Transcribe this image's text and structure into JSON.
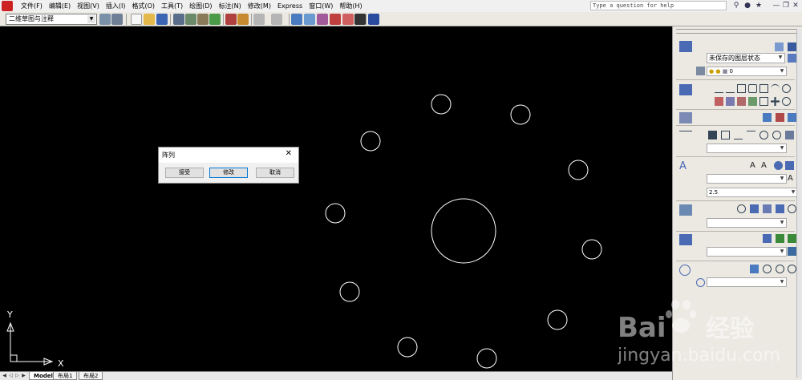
{
  "menubar": {
    "items": [
      "文件(F)",
      "编辑(E)",
      "视图(V)",
      "插入(I)",
      "格式(O)",
      "工具(T)",
      "绘图(D)",
      "标注(N)",
      "修改(M)",
      "Express",
      "窗口(W)",
      "帮助(H)"
    ],
    "help_placeholder": "Type a question for help"
  },
  "toolbar": {
    "workspace": "二维草图与注释"
  },
  "canvas": {
    "background": "#000000",
    "ucs_x_label": "X",
    "ucs_y_label": "Y"
  },
  "layout_tabs": [
    "Model",
    "布局1",
    "布局2"
  ],
  "dashboard": {
    "layer_state": "未保存的图层状态",
    "layer_current": "0",
    "text_height": "2.5"
  },
  "array_dialog": {
    "title": "阵列",
    "close_symbol": "✕",
    "buttons": {
      "accept": "接受",
      "modify": "修改",
      "cancel": "取消"
    }
  },
  "watermark": {
    "brand": "Bai",
    "brand_suffix": "经验",
    "url": "jingyan.baidu.com"
  }
}
